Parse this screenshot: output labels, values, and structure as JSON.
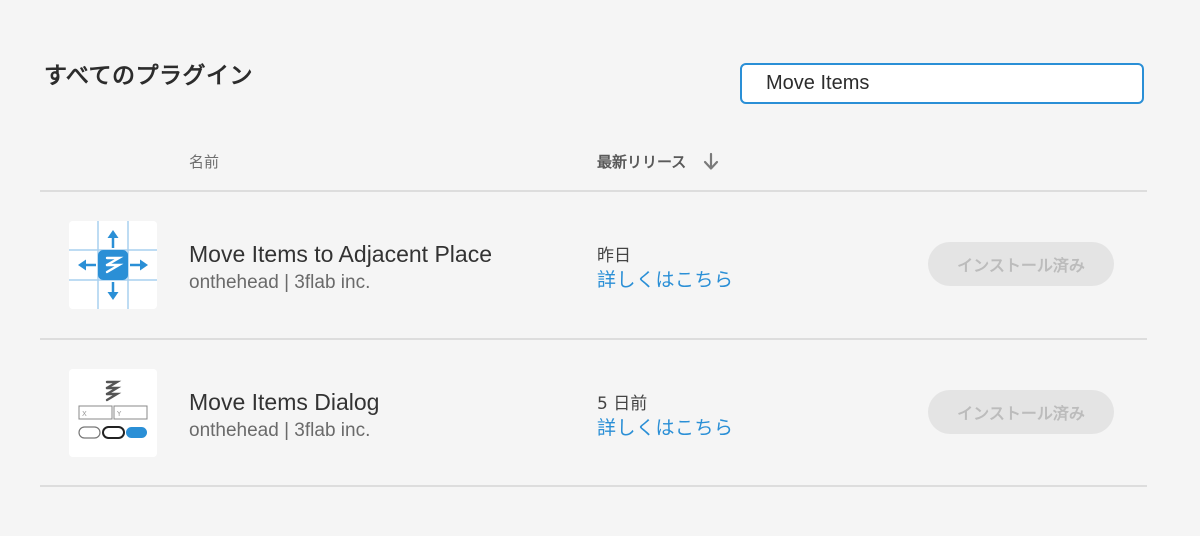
{
  "page": {
    "title": "すべてのプラグイン"
  },
  "search": {
    "value": "Move Items"
  },
  "table": {
    "columns": {
      "name": "名前",
      "release": "最新リリース"
    },
    "rows": [
      {
        "name": "Move Items to Adjacent Place",
        "author": "onthehead | 3flab inc.",
        "release": "昨日",
        "link": "詳しくはこちら",
        "install_label": "インストール済み",
        "icon": "move-adjacent-plugin-icon"
      },
      {
        "name": "Move Items Dialog",
        "author": "onthehead | 3flab inc.",
        "release": "5 日前",
        "link": "詳しくはこちら",
        "install_label": "インストール済み",
        "icon": "move-dialog-plugin-icon",
        "field_labels": [
          "X",
          "Y"
        ]
      }
    ]
  },
  "colors": {
    "accent": "#2a8fd6",
    "background": "#f5f5f5",
    "disabled_button": "#e4e4e4"
  }
}
